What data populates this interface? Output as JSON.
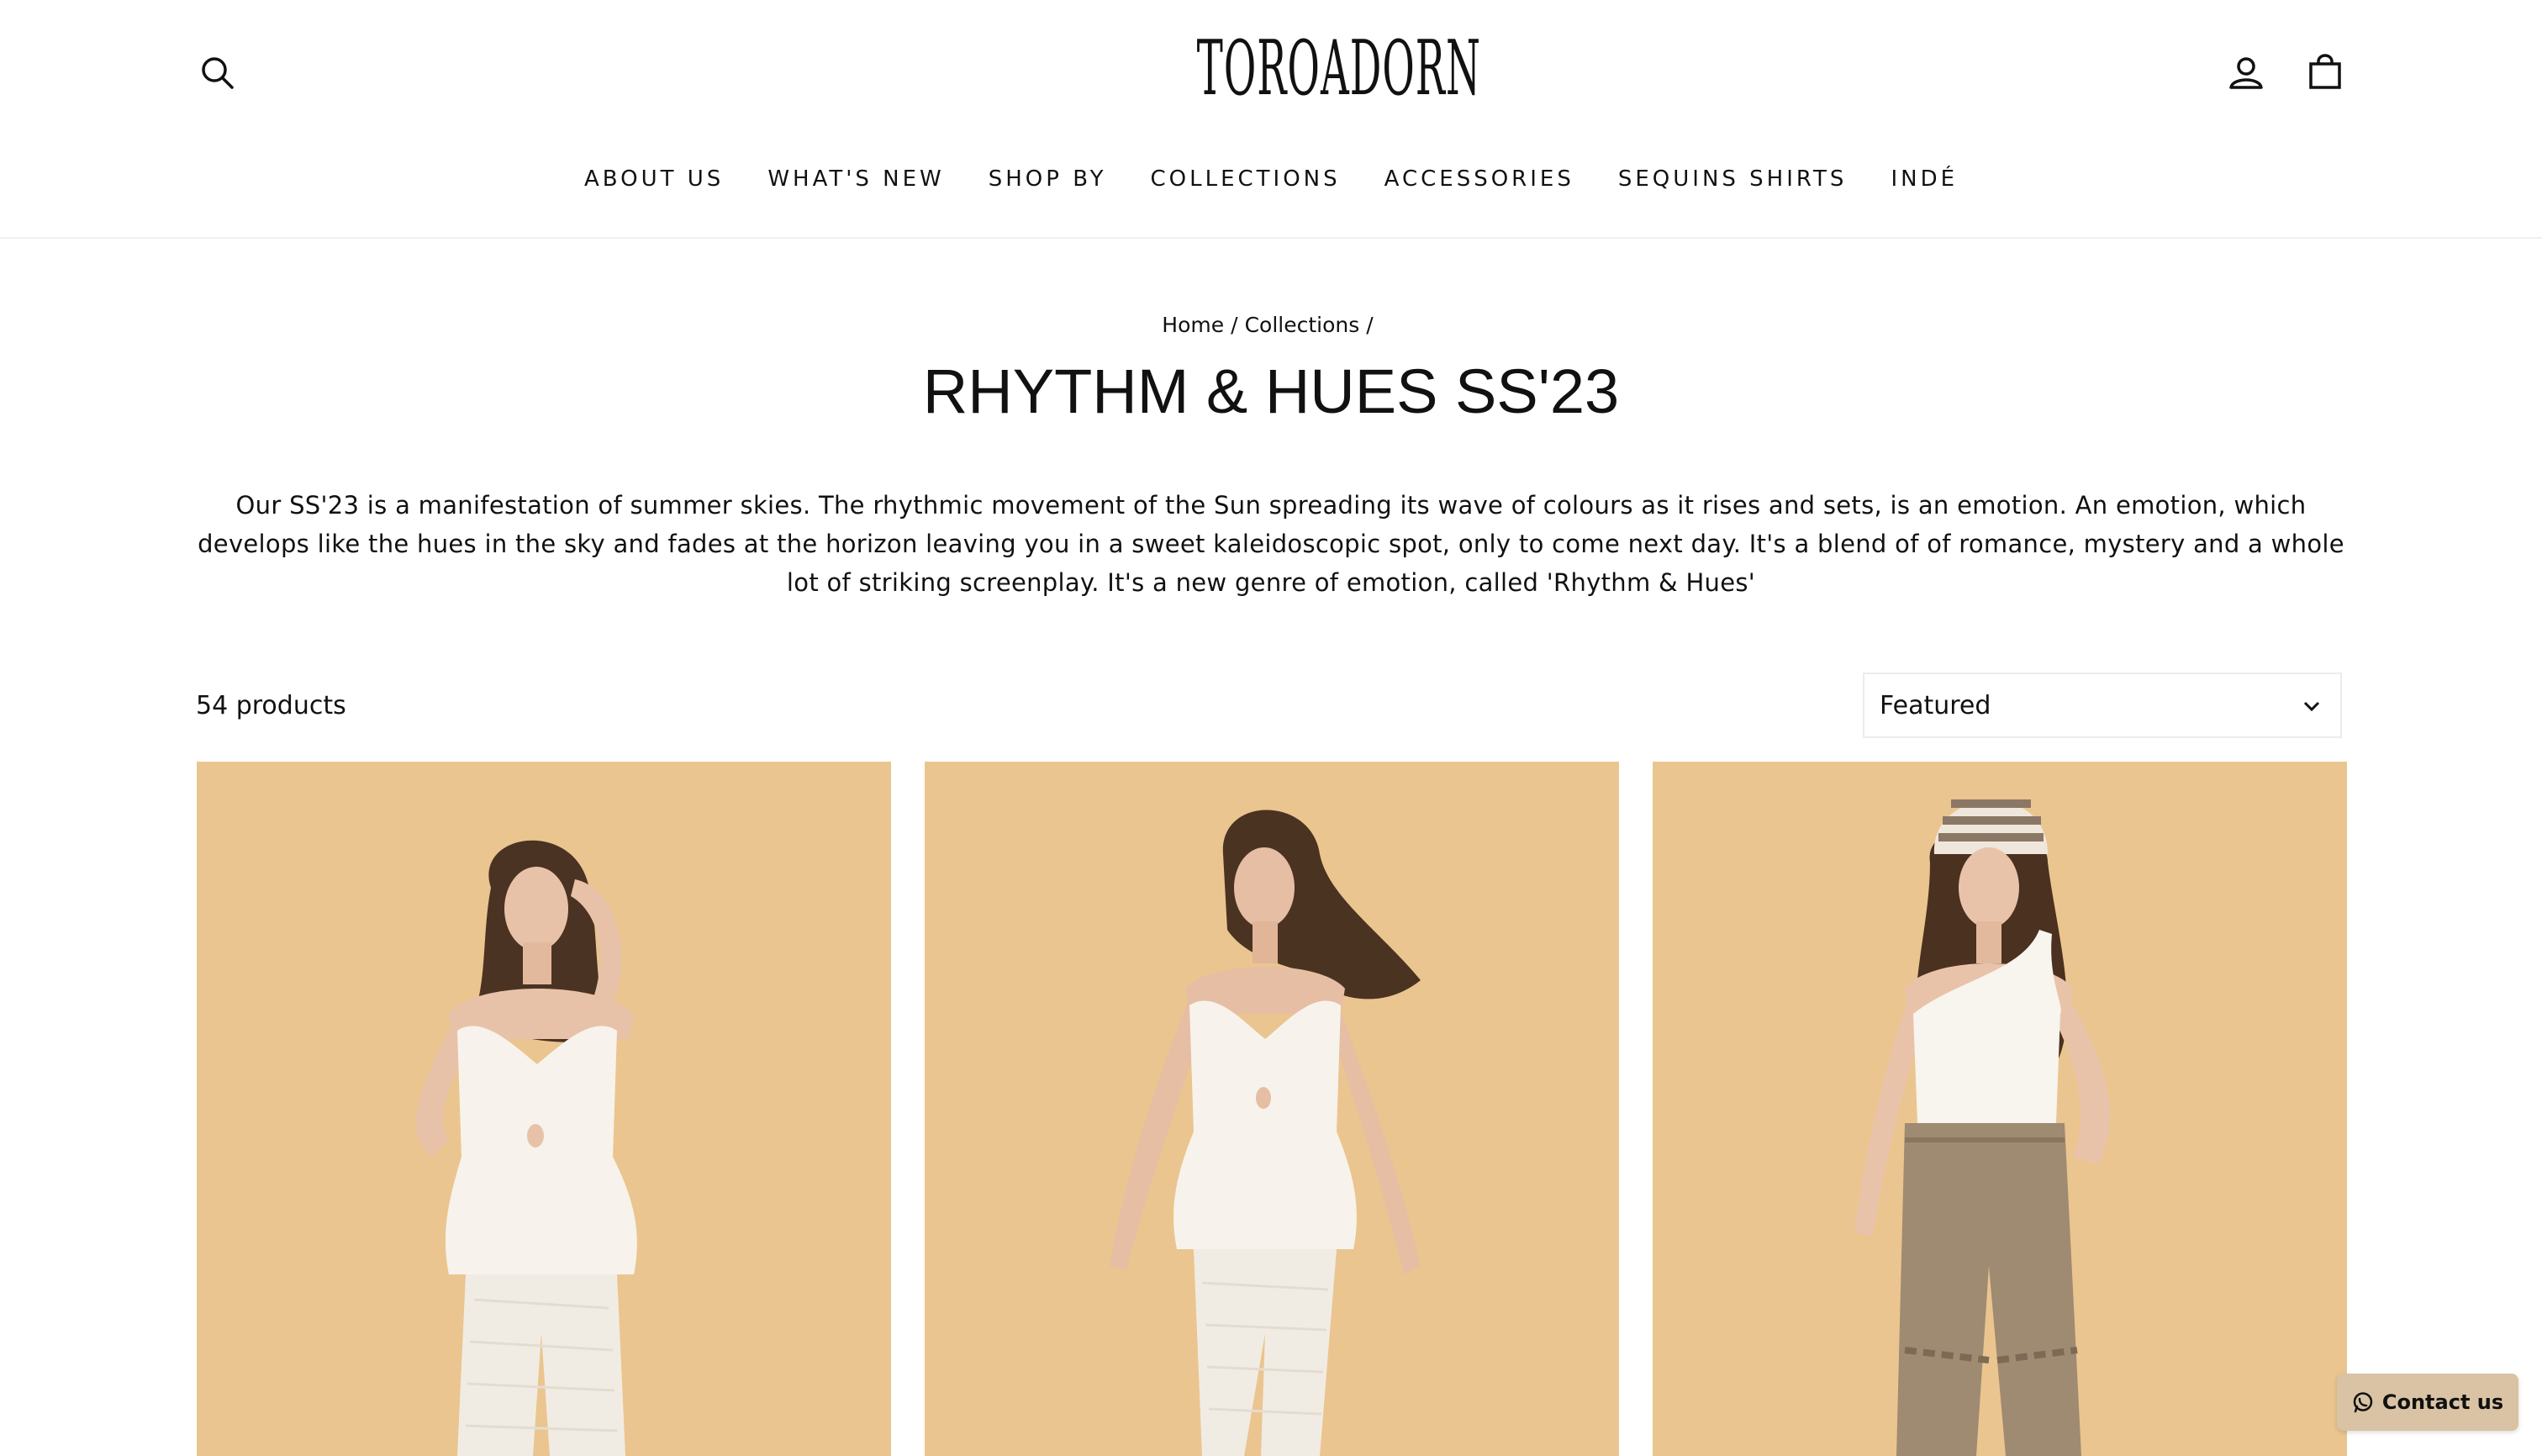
{
  "brand": {
    "logo_text": "TOROADORN"
  },
  "header": {
    "icons": {
      "search": "search-icon",
      "account": "user-icon",
      "cart": "bag-icon"
    }
  },
  "nav": {
    "items": [
      {
        "label": "ABOUT US"
      },
      {
        "label": "WHAT'S NEW"
      },
      {
        "label": "SHOP BY"
      },
      {
        "label": "COLLECTIONS"
      },
      {
        "label": "ACCESSORIES"
      },
      {
        "label": "SEQUINS SHIRTS"
      },
      {
        "label": "INDÉ"
      }
    ]
  },
  "breadcrumb": {
    "home": "Home",
    "collections": "Collections",
    "separator": "/"
  },
  "collection": {
    "title": "RHYTHM & HUES SS'23",
    "description": "Our SS'23 is a manifestation of summer skies. The rhythmic movement of the Sun spreading its wave of colours as it rises and sets, is an emotion. An emotion, which develops like the hues in the sky and fades at the horizon leaving you in a sweet kaleidoscopic spot, only to come next day. It's a blend of of romance, mystery and a whole lot of striking screenplay. It's a new genre of emotion, called 'Rhythm & Hues'"
  },
  "toolbar": {
    "product_count": "54 products",
    "sort_selected": "Featured"
  },
  "products": [
    {
      "image": "model-white-peplum-top-pants"
    },
    {
      "image": "model-white-peplum-top-pants-walking"
    },
    {
      "image": "model-white-tank-khaki-trousers-beanie"
    }
  ],
  "contact": {
    "label": "Contact us",
    "icon": "whatsapp-icon"
  },
  "colors": {
    "accent": "#d9c3a4",
    "photo_background": "#ebc58f",
    "text": "#111111"
  }
}
